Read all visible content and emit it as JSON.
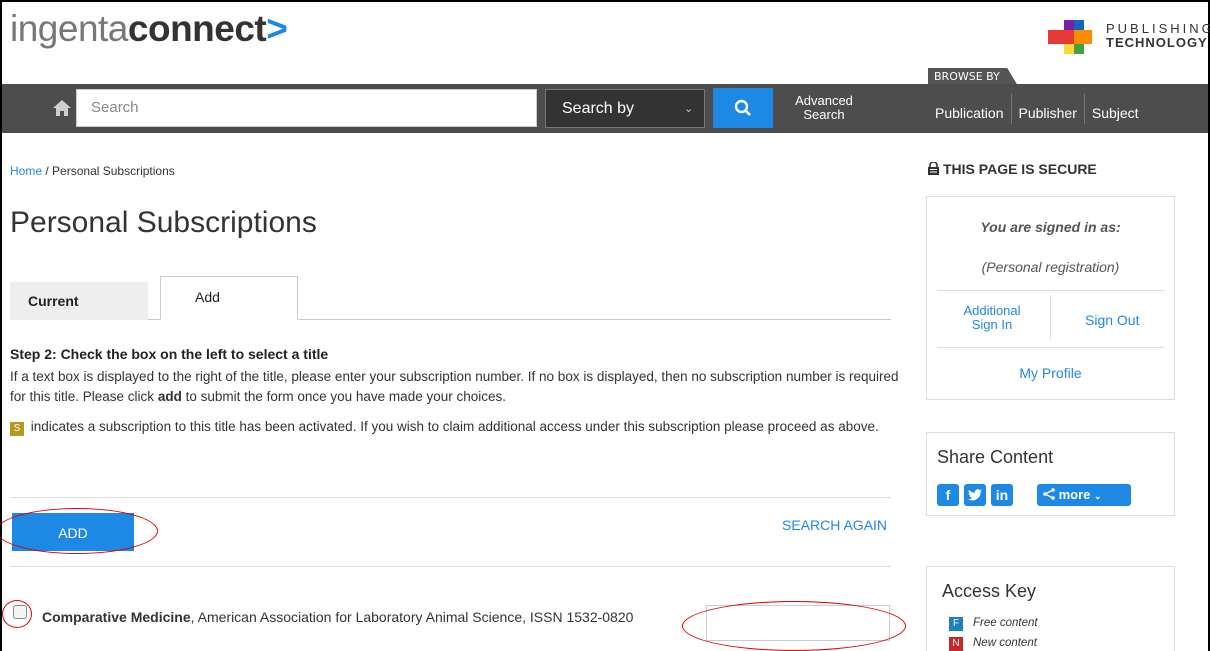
{
  "header": {
    "logo_light": "ingenta",
    "logo_bold": "connect",
    "logo_arrow": ">",
    "partner_line1": "PUBLISHING",
    "partner_line2": "TECHNOLOGY"
  },
  "nav": {
    "home_icon": "home-icon",
    "search_placeholder": "Search",
    "search_by_label": "Search by",
    "search_button_icon": "search-icon",
    "advanced_search_label": "Advanced Search",
    "browse_by_label": "BROWSE BY",
    "browse_links": [
      "Publication",
      "Publisher",
      "Subject"
    ]
  },
  "breadcrumb": {
    "home": "Home",
    "separator": "/",
    "current": "Personal Subscriptions"
  },
  "page": {
    "title": "Personal Subscriptions",
    "tabs": [
      {
        "label": "Current",
        "active": false
      },
      {
        "label": "Add",
        "active": true
      }
    ],
    "step_heading": "Step 2: Check the box on the left to select a title",
    "para1_a": "If a text box is displayed to the right of the title, please enter your subscription number. If no box is displayed, then no subscription number is required for this title. Please click ",
    "para1_bold": "add",
    "para1_b": " to submit the form once you have made your choices.",
    "badge_letter": "S",
    "para2": " indicates a subscription to this title has been activated. If you wish to claim additional access under this subscription please proceed as above.",
    "add_button": "ADD",
    "search_again": "SEARCH AGAIN",
    "title_entry": {
      "name": "Comparative Medicine",
      "detail": ", American Association for Laboratory Animal Science, ISSN 1532-0820",
      "subscription_number": ""
    }
  },
  "sidebar": {
    "secure_label": "THIS PAGE IS SECURE",
    "signed_in_as": "You are signed in as:",
    "registration": "(Personal registration)",
    "additional_sign_in": "Additional Sign In",
    "sign_out": "Sign Out",
    "my_profile": "My Profile",
    "share_title": "Share Content",
    "share_more": "more",
    "access_key_title": "Access Key",
    "access_keys": [
      {
        "letter": "F",
        "label": "Free content",
        "color": "#1e7fc4"
      },
      {
        "letter": "N",
        "label": "New content",
        "color": "#c62828"
      }
    ]
  },
  "colors": {
    "accent": "#1e88e5",
    "navbar": "#4d4d4d",
    "annotation": "#dd0000"
  }
}
